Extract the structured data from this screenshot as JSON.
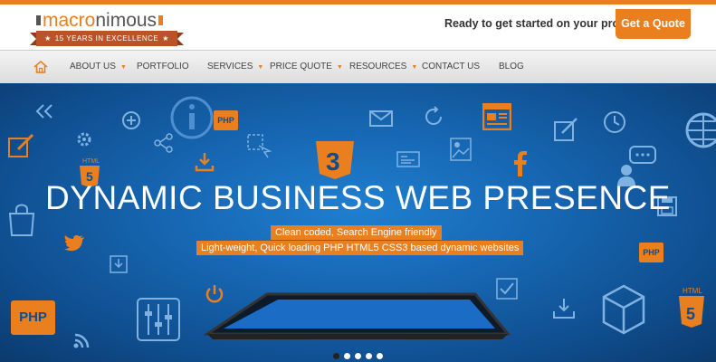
{
  "header": {
    "logo": {
      "text_orange": "macro",
      "text_grey": "nimous",
      "tagline": "15 YEARS IN EXCELLENCE"
    },
    "cta_text": "Ready to get started on your project?",
    "cta_button": "Get a Quote"
  },
  "nav": {
    "items": [
      {
        "label": "ABOUT US",
        "has_dropdown": true
      },
      {
        "label": "PORTFOLIO",
        "has_dropdown": false
      },
      {
        "label": "SERVICES",
        "has_dropdown": true
      },
      {
        "label": "PRICE QUOTE",
        "has_dropdown": true
      },
      {
        "label": "RESOURCES",
        "has_dropdown": true
      },
      {
        "label": "CONTACT US",
        "has_dropdown": false
      },
      {
        "label": "BLOG",
        "has_dropdown": false
      }
    ]
  },
  "hero": {
    "title": "DYNAMIC BUSINESS WEB PRESENCE",
    "badge1": "Clean coded, Search Engine friendly",
    "badge2": "Light-weight, Quick loading PHP HTML5 CSS3 based dynamic websites",
    "icon_labels": {
      "php": "PHP",
      "html": "HTML",
      "five": "5",
      "three": "3"
    },
    "slides": 5,
    "active_slide": 1
  },
  "colors": {
    "accent": "#e97f1f",
    "hero_blue": "#1665b0",
    "nav_bg": "#e6e6e6"
  }
}
